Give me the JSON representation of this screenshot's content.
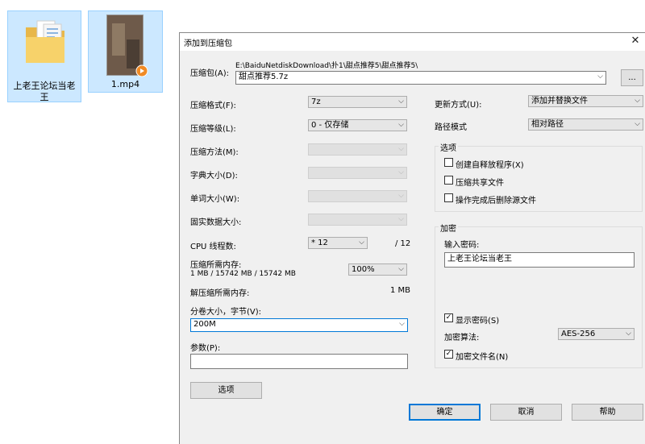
{
  "desktop": {
    "folder_label_line1": "上老王论坛当老",
    "folder_label_line2": "王",
    "video_label": "1.mp4"
  },
  "dialog": {
    "title": "添加到压缩包",
    "archive_label": "压缩包(A):",
    "archive_path": "E:\\BaiduNetdiskDownload\\扑1\\甜点推荐5\\甜点推荐5\\",
    "archive_name": "甜点推荐5.7z",
    "browse_label": "...",
    "format_label": "压缩格式(F):",
    "format_value": "7z",
    "level_label": "压缩等级(L):",
    "level_value": "0 - 仅存储",
    "method_label": "压缩方法(M):",
    "dict_label": "字典大小(D):",
    "word_label": "单词大小(W):",
    "solid_label": "固实数据大小:",
    "threads_label": "CPU 线程数:",
    "threads_value": "* 12",
    "threads_total": "/ 12",
    "mem_comp_label": "压缩所需内存:",
    "mem_comp_value": "1 MB / 15742 MB / 15742 MB",
    "mem_percent": "100%",
    "mem_decomp_label": "解压缩所需内存:",
    "mem_decomp_value": "1 MB",
    "volume_label": "分卷大小，字节(V):",
    "volume_value": "200M",
    "params_label": "参数(P):",
    "params_value": "",
    "options_button": "选项",
    "update_label": "更新方式(U):",
    "update_value": "添加并替换文件",
    "path_label": "路径模式",
    "path_value": "相对路径",
    "options_group": "选项",
    "opt_sfx": "创建自释放程序(X)",
    "opt_shared": "压缩共享文件",
    "opt_delete": "操作完成后删除源文件",
    "encrypt_group": "加密",
    "password_label": "输入密码:",
    "password_value": "上老王论坛当老王",
    "show_password": "显示密码(S)",
    "enc_method_label": "加密算法:",
    "enc_method_value": "AES-256",
    "encrypt_names": "加密文件名(N)",
    "ok_button": "确定",
    "cancel_button": "取消",
    "help_button": "帮助"
  },
  "colors": {
    "selection_bg": "#cce8ff",
    "accent": "#0078d7",
    "dialog_bg": "#f0f0f0"
  }
}
